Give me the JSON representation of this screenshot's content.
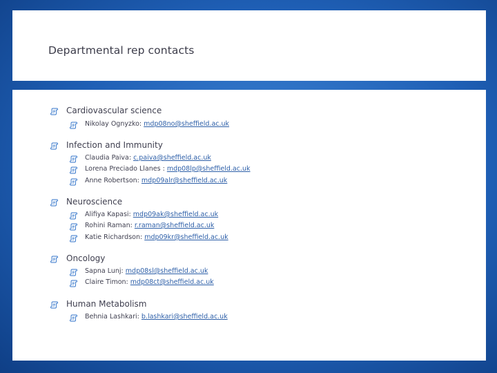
{
  "slide": {
    "title": "Departmental rep contacts",
    "accent_color": "#2f72c9",
    "bullet_icon": "scroll-bullet-icon",
    "sections": [
      {
        "heading": "Cardiovascular science",
        "contacts": [
          {
            "name": "Nikolay Ognyzko: ",
            "email": "mdp08no@sheffield.ac.uk"
          }
        ]
      },
      {
        "heading": "Infection and Immunity",
        "contacts": [
          {
            "name": "Claudia Paiva: ",
            "email": "c.paiva@sheffield.ac.uk"
          },
          {
            "name": "Lorena Preciado Llanes : ",
            "email": "mdp08lp@sheffield.ac.uk"
          },
          {
            "name": "Anne Robertson: ",
            "email": "mdp09alr@sheffield.ac.uk"
          }
        ]
      },
      {
        "heading": "Neuroscience",
        "contacts": [
          {
            "name": "Alifiya Kapasi: ",
            "email": "mdp09ak@sheffield.ac.uk"
          },
          {
            "name": "Rohini Raman: ",
            "email": "r.raman@sheffield.ac.uk"
          },
          {
            "name": "Katie Richardson: ",
            "email": "mdp09kr@sheffield.ac.uk"
          }
        ]
      },
      {
        "heading": "Oncology",
        "contacts": [
          {
            "name": "Sapna Lunj: ",
            "email": "mdp08sl@sheffield.ac.uk"
          },
          {
            "name": "Claire Timon: ",
            "email": "mdp08ct@sheffield.ac.uk"
          }
        ]
      },
      {
        "heading": "Human Metabolism",
        "contacts": [
          {
            "name": "Behnia Lashkari: ",
            "email": "b.lashkari@sheffield.ac.uk"
          }
        ]
      }
    ]
  }
}
